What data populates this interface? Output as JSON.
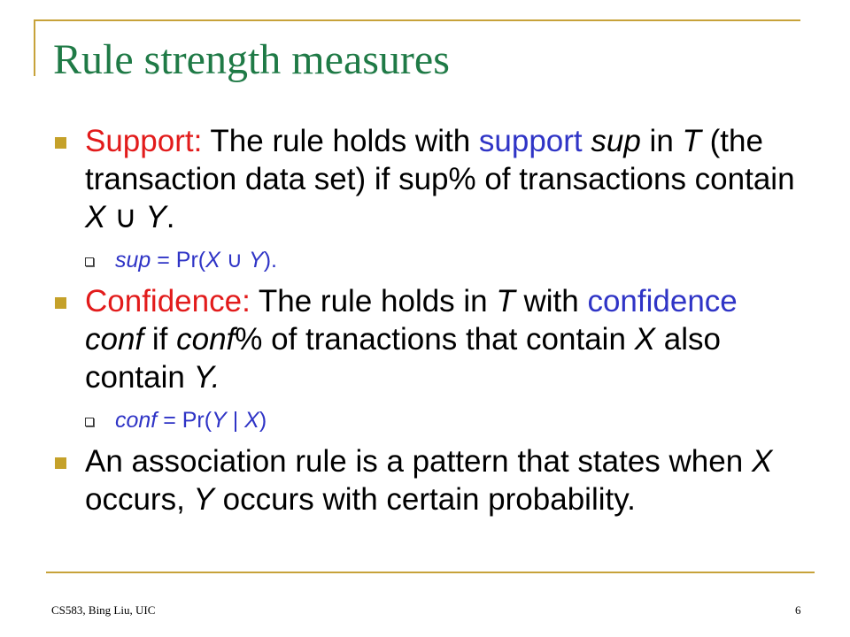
{
  "slide": {
    "title": "Rule strength measures",
    "bullets": {
      "support": {
        "label": "Support:",
        "t1": " The rule holds with ",
        "term": "support",
        "t2": " ",
        "var_sup": "sup",
        "t3": " in ",
        "var_T": "T",
        "t4": " (the transaction data set) if sup% of transactions contain ",
        "var_X": "X",
        "union": " ∪ ",
        "var_Y": "Y",
        "t5": ".",
        "formula": {
          "lhs": "sup",
          "eq": " = Pr(",
          "x": "X",
          "union": " ∪ ",
          "y": "Y",
          "end": ")."
        }
      },
      "confidence": {
        "label": "Confidence:",
        "t1": " The rule holds in ",
        "var_T": "T",
        "t2": " with ",
        "term": "confidence",
        "t3": " ",
        "var_conf": "conf",
        "t4": " if ",
        "var_conf2": "conf",
        "t5": "% of tranactions that contain ",
        "var_X": "X",
        "t6": " also contain ",
        "var_Y": "Y.",
        "formula": {
          "lhs": "conf",
          "eq": " = Pr(",
          "y": "Y",
          "bar": " | ",
          "x": "X",
          "end": ")"
        }
      },
      "association": {
        "t1": "An association rule is a pattern that states when ",
        "var_X": "X",
        "t2": " occurs, ",
        "var_Y": "Y",
        "t3": " occurs with certain probability."
      }
    }
  },
  "footer": {
    "left": "CS583, Bing Liu, UIC",
    "page": "6"
  },
  "colors": {
    "title": "#1f7a46",
    "label": "#e21b1b",
    "term": "#2f34c6",
    "bullet": "#c5a12a",
    "frame": "#c7a23a"
  }
}
